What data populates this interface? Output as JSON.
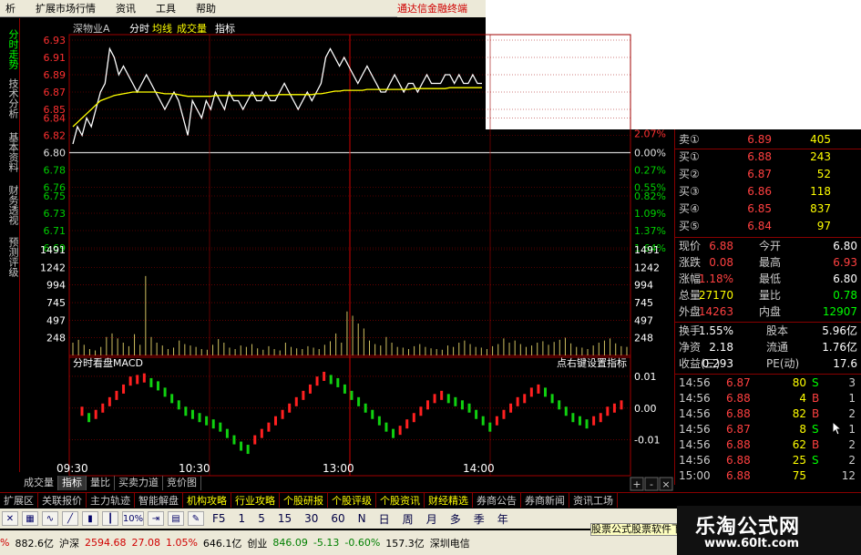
{
  "menu": [
    "析",
    "扩展市场行情",
    "资讯",
    "工具",
    "帮助"
  ],
  "menu_brand": "通达信金融终端",
  "side_tabs": [
    {
      "label": "分时走势",
      "active": true
    },
    {
      "label": "技术分析",
      "active": false
    },
    {
      "label": "基本资料",
      "active": false
    },
    {
      "label": "财务透视",
      "active": false
    },
    {
      "label": "预测评级",
      "active": false
    }
  ],
  "chart_header": {
    "stock": "深物业A",
    "mode": "分时",
    "avg_label": "均线",
    "vol_label": "成交量",
    "indicator_label": "指标"
  },
  "macd_header": {
    "title": "分时看盘MACD",
    "hint": "点右键设置指标"
  },
  "chart_data": [
    {
      "type": "line",
      "title": "",
      "x_ticks": [
        "09:30",
        "10:30",
        "13:00",
        "14:00"
      ],
      "ylim": [
        6.69,
        6.93
      ],
      "y_ticks_left": [
        "6.93",
        "6.91",
        "6.89",
        "6.87",
        "6.85",
        "6.84",
        "6.82",
        "6.80",
        "6.78",
        "6.76",
        "6.75",
        "6.73",
        "6.71",
        "6.69"
      ],
      "y_ticks_right": [
        "0.00%",
        "0.27%",
        "0.55%",
        "0.82%",
        "1.09%",
        "1.37%",
        "1.64%"
      ],
      "y_ticks_right_top": "2.07%",
      "series": [
        {
          "name": "分时",
          "values": [
            6.81,
            6.83,
            6.82,
            6.84,
            6.83,
            6.85,
            6.87,
            6.88,
            6.92,
            6.91,
            6.89,
            6.9,
            6.89,
            6.88,
            6.87,
            6.88,
            6.89,
            6.88,
            6.87,
            6.86,
            6.85,
            6.86,
            6.87,
            6.86,
            6.84,
            6.82,
            6.86,
            6.85,
            6.84,
            6.86,
            6.85,
            6.87,
            6.86,
            6.85,
            6.87,
            6.86,
            6.86,
            6.85,
            6.86,
            6.87,
            6.86,
            6.86,
            6.87,
            6.86,
            6.86,
            6.87,
            6.88,
            6.87,
            6.86,
            6.85,
            6.86,
            6.87,
            6.86,
            6.87,
            6.88,
            6.91,
            6.92,
            6.91,
            6.9,
            6.91,
            6.9,
            6.89,
            6.88,
            6.89,
            6.9,
            6.89,
            6.88,
            6.87,
            6.87,
            6.88,
            6.89,
            6.88,
            6.87,
            6.88,
            6.88,
            6.87,
            6.88,
            6.89,
            6.88,
            6.88,
            6.88,
            6.89,
            6.89,
            6.88,
            6.89,
            6.88,
            6.88,
            6.89,
            6.88,
            6.88
          ]
        },
        {
          "name": "均线",
          "values": [
            6.83,
            6.835,
            6.84,
            6.845,
            6.85,
            6.855,
            6.86,
            6.862,
            6.864,
            6.866,
            6.867,
            6.868,
            6.869,
            6.87,
            6.87,
            6.87,
            6.87,
            6.87,
            6.87,
            6.869,
            6.868,
            6.868,
            6.868,
            6.867,
            6.866,
            6.865,
            6.865,
            6.865,
            6.865,
            6.865,
            6.865,
            6.866,
            6.866,
            6.866,
            6.866,
            6.866,
            6.866,
            6.866,
            6.866,
            6.866,
            6.866,
            6.866,
            6.866,
            6.866,
            6.866,
            6.867,
            6.867,
            6.867,
            6.867,
            6.867,
            6.867,
            6.867,
            6.867,
            6.868,
            6.868,
            6.869,
            6.87,
            6.871,
            6.871,
            6.872,
            6.872,
            6.872,
            6.872,
            6.872,
            6.873,
            6.873,
            6.873,
            6.873,
            6.873,
            6.873,
            6.873,
            6.873,
            6.873,
            6.873,
            6.874,
            6.874,
            6.874,
            6.874,
            6.874,
            6.874,
            6.874,
            6.874,
            6.875,
            6.875,
            6.875,
            6.875,
            6.875,
            6.875,
            6.875,
            6.875
          ]
        }
      ]
    },
    {
      "type": "bar",
      "title": "",
      "y_ticks": [
        "1491",
        "1242",
        "994",
        "745",
        "497",
        "248"
      ],
      "ylim": [
        0,
        1491
      ],
      "values": [
        180,
        220,
        150,
        90,
        70,
        120,
        260,
        310,
        240,
        180,
        130,
        300,
        150,
        1120,
        260,
        180,
        140,
        90,
        110,
        210,
        160,
        140,
        120,
        90,
        80,
        150,
        230,
        180,
        110,
        90,
        140,
        120,
        160,
        100,
        80,
        130,
        90,
        70,
        180,
        120,
        100,
        90,
        130,
        110,
        90,
        150,
        200,
        310,
        180,
        620,
        560,
        450,
        380,
        210,
        160,
        140,
        260,
        180,
        120,
        110,
        90,
        130,
        160,
        120,
        100,
        90,
        80,
        140,
        120,
        180,
        210,
        160,
        120,
        110,
        90,
        130,
        160,
        240,
        180,
        210,
        160,
        120,
        140,
        180,
        200,
        150,
        190,
        220,
        250,
        170,
        120,
        110,
        90,
        140,
        180,
        210,
        240,
        170,
        130,
        120
      ]
    },
    {
      "type": "bar",
      "title": "",
      "y_ticks": [
        "0.01",
        "0.00",
        "-0.01"
      ],
      "ylim": [
        -0.015,
        0.012
      ],
      "values": [
        -0.001,
        -0.003,
        -0.002,
        0.0,
        0.002,
        0.004,
        0.006,
        0.0085,
        0.009,
        0.0095,
        0.008,
        0.007,
        0.005,
        0.003,
        0.001,
        -0.001,
        -0.002,
        -0.003,
        -0.004,
        -0.005,
        -0.006,
        -0.008,
        -0.01,
        -0.012,
        -0.013,
        -0.01,
        -0.008,
        -0.006,
        -0.004,
        -0.002,
        0.0,
        0.002,
        0.004,
        0.006,
        0.0085,
        0.01,
        0.009,
        0.008,
        0.006,
        0.004,
        0.002,
        0.0,
        -0.002,
        -0.004,
        -0.006,
        -0.008,
        -0.007,
        -0.005,
        -0.003,
        -0.001,
        0.001,
        0.003,
        0.004,
        0.003,
        0.002,
        0.001,
        0.0,
        -0.002,
        -0.004,
        -0.006,
        -0.004,
        -0.002,
        0.0,
        0.002,
        0.003,
        0.005,
        0.006,
        0.005,
        0.003,
        0.001,
        -0.001,
        -0.003,
        -0.004,
        -0.005,
        -0.004,
        -0.003,
        -0.001,
        0.0,
        0.001
      ]
    }
  ],
  "quote": {
    "sell1": {
      "label": "卖①",
      "price": "6.89",
      "vol": "405"
    },
    "buy": [
      {
        "label": "买①",
        "price": "6.88",
        "vol": "243"
      },
      {
        "label": "买②",
        "price": "6.87",
        "vol": "52"
      },
      {
        "label": "买③",
        "price": "6.86",
        "vol": "118"
      },
      {
        "label": "买④",
        "price": "6.85",
        "vol": "837"
      },
      {
        "label": "买⑤",
        "price": "6.84",
        "vol": "97"
      }
    ],
    "stats": [
      {
        "l1": "现价",
        "v1": "6.88",
        "l2": "今开",
        "v2": "6.80",
        "c2": "#ffffff"
      },
      {
        "l1": "涨跌",
        "v1": "0.08",
        "l2": "最高",
        "v2": "6.93",
        "c2": "#ff4040"
      },
      {
        "l1": "涨幅",
        "v1": "1.18%",
        "l2": "最低",
        "v2": "6.80",
        "c2": "#ffffff"
      },
      {
        "l1": "总量",
        "v1": "27170",
        "l2": "量比",
        "v2": "0.78",
        "c2": "#00ff00"
      },
      {
        "l1": "外盘",
        "v1": "14263",
        "l2": "内盘",
        "v2": "12907",
        "c2": "#00ff00"
      }
    ],
    "stats2": [
      {
        "l1": "换手",
        "v1": "1.55%",
        "l2": "股本",
        "v2": "5.96亿"
      },
      {
        "l1": "净资",
        "v1": "2.18",
        "l2": "流通",
        "v2": "1.76亿"
      },
      {
        "l1": "收益(三)",
        "v1": "0.293",
        "l2": "PE(动)",
        "v2": "17.6"
      }
    ],
    "ticks": [
      {
        "t": "14:56",
        "p": "6.87",
        "q": "80",
        "d": "S",
        "n": "3"
      },
      {
        "t": "14:56",
        "p": "6.88",
        "q": "4",
        "d": "B",
        "n": "1"
      },
      {
        "t": "14:56",
        "p": "6.88",
        "q": "82",
        "d": "B",
        "n": "2"
      },
      {
        "t": "14:56",
        "p": "6.87",
        "q": "8",
        "d": "S",
        "n": "1"
      },
      {
        "t": "14:56",
        "p": "6.88",
        "q": "62",
        "d": "B",
        "n": "2"
      },
      {
        "t": "14:56",
        "p": "6.88",
        "q": "25",
        "d": "S",
        "n": "2"
      },
      {
        "t": "15:00",
        "p": "6.88",
        "q": "75",
        "d": "",
        "n": "12"
      }
    ],
    "color_up": "#ff4040",
    "color_down": "#00ff00"
  },
  "bottom_tabs": [
    "成交量",
    "指标",
    "量比",
    "买卖力道",
    "竞价图"
  ],
  "scroll_controls": [
    "+",
    "-",
    "×"
  ],
  "sections": [
    "扩展区",
    "关联报价",
    "主力轨迹",
    "智能解盘",
    "机构攻略",
    "行业攻略",
    "个股研报",
    "个股评级",
    "个股资讯",
    "财经精选",
    "券商公告",
    "券商新闻",
    "资讯工场"
  ],
  "toolbar_icons": [
    "x-icon",
    "table-icon",
    "wave-icon",
    "line-icon",
    "bars-icon",
    "candle-icon",
    "pct-icon",
    "export-icon",
    "grid-icon",
    "pencil-icon"
  ],
  "toolbar_pct": "10%",
  "toolbar_periods": [
    "F5",
    "1",
    "5",
    "15",
    "30",
    "60",
    "N",
    "日",
    "周",
    "月",
    "多",
    "季",
    "年"
  ],
  "status": [
    {
      "text": "%",
      "cls": "red"
    },
    {
      "text": "882.6亿",
      "cls": ""
    },
    {
      "text": "沪深",
      "cls": ""
    },
    {
      "text": "2594.68",
      "cls": "red"
    },
    {
      "text": "27.08",
      "cls": "red"
    },
    {
      "text": "1.05%",
      "cls": "red"
    },
    {
      "text": "646.1亿",
      "cls": ""
    },
    {
      "text": "创业",
      "cls": ""
    },
    {
      "text": "846.09",
      "cls": "grn"
    },
    {
      "text": "-5.13",
      "cls": "grn"
    },
    {
      "text": "-0.60%",
      "cls": "grn"
    },
    {
      "text": "157.3亿",
      "cls": ""
    },
    {
      "text": "深圳电信",
      "cls": ""
    }
  ],
  "ticker_text": "股票公式股票软件下",
  "watermark": {
    "line1": "乐淘公式网",
    "line2": "www.60lt.com"
  }
}
